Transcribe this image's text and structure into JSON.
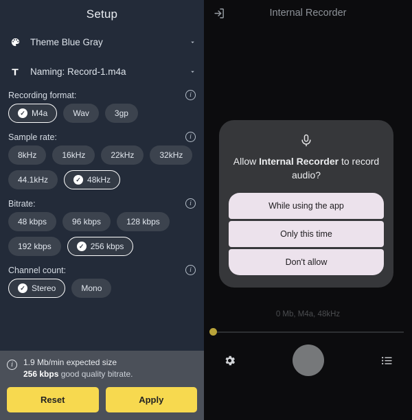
{
  "setup": {
    "title": "Setup",
    "options": [
      {
        "icon": "palette-icon",
        "label": "Theme Blue Gray"
      },
      {
        "icon": "text-format-icon",
        "label": "Naming: Record-1.m4a"
      }
    ],
    "sections": [
      {
        "key": "recording_format",
        "label": "Recording format:",
        "info": "i",
        "chips": [
          {
            "label": "M4a",
            "selected": true
          },
          {
            "label": "Wav",
            "selected": false
          },
          {
            "label": "3gp",
            "selected": false
          }
        ]
      },
      {
        "key": "sample_rate",
        "label": "Sample rate:",
        "info": "i",
        "chips": [
          {
            "label": "8kHz",
            "selected": false
          },
          {
            "label": "16kHz",
            "selected": false
          },
          {
            "label": "22kHz",
            "selected": false
          },
          {
            "label": "32kHz",
            "selected": false
          },
          {
            "label": "44.1kHz",
            "selected": false
          },
          {
            "label": "48kHz",
            "selected": true
          }
        ]
      },
      {
        "key": "bitrate",
        "label": "Bitrate:",
        "info": "i",
        "chips": [
          {
            "label": "48 kbps",
            "selected": false
          },
          {
            "label": "96 kbps",
            "selected": false
          },
          {
            "label": "128 kbps",
            "selected": false
          },
          {
            "label": "192 kbps",
            "selected": false
          },
          {
            "label": "256 kbps",
            "selected": true
          }
        ]
      },
      {
        "key": "channel_count",
        "label": "Channel count:",
        "info": "i",
        "chips": [
          {
            "label": "Stereo",
            "selected": true
          },
          {
            "label": "Mono",
            "selected": false
          }
        ]
      }
    ],
    "info_bar": {
      "line1": "1.9 Mb/min expected size",
      "line2_bold": "256 kbps",
      "line2_rest": " good quality bitrate."
    },
    "actions": {
      "reset_label": "Reset",
      "apply_label": "Apply"
    }
  },
  "recorder": {
    "title": "Internal Recorder",
    "header_icon": "exit-to-app-icon",
    "status": "0 Mb, M4a, 48kHz",
    "slider_value": 0,
    "permission_dialog": {
      "icon": "microphone-icon",
      "message_prefix": "Allow ",
      "message_app": "Internal Recorder",
      "message_suffix": " to record audio?",
      "buttons": [
        "While using the app",
        "Only this time",
        "Don't allow"
      ]
    },
    "controls": {
      "settings_icon": "gear-icon",
      "record_button": "record-button",
      "list_icon": "list-icon"
    }
  },
  "colors": {
    "accent_yellow": "#f7d94f",
    "panel_bg": "#232b39",
    "chip_bg": "#3c434e",
    "dialog_bg": "#36373a",
    "dialog_button": "#ece2ec"
  }
}
